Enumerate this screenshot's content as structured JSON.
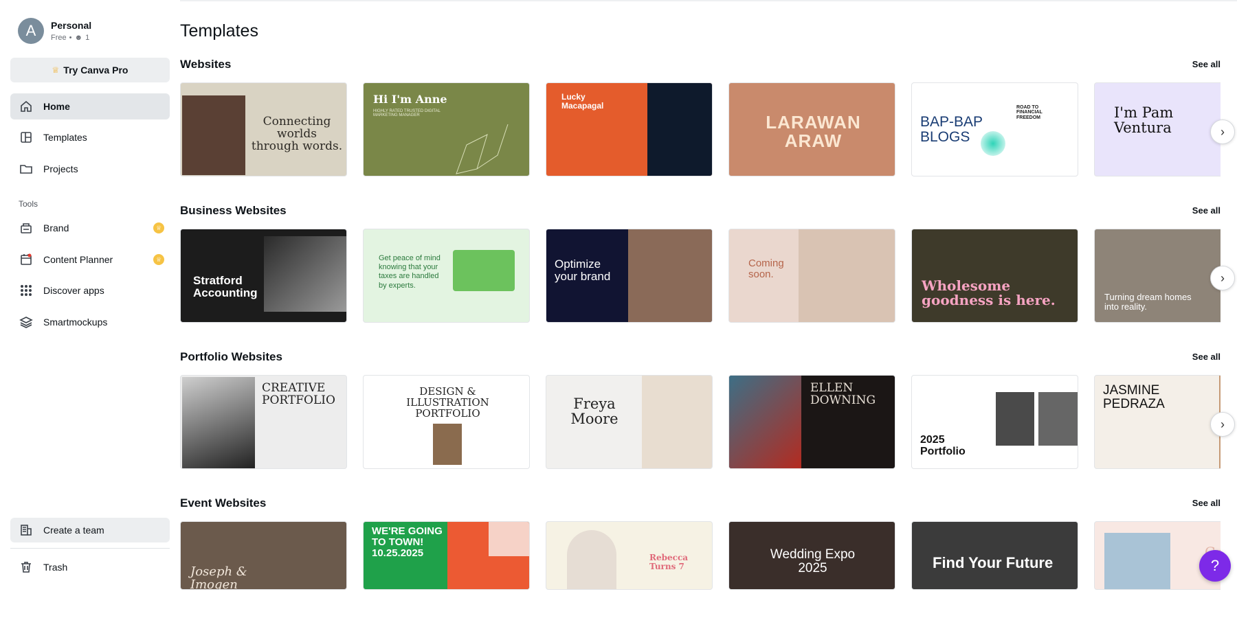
{
  "account": {
    "initial": "A",
    "name": "Personal",
    "plan": "Free",
    "members": "1"
  },
  "sidebar": {
    "try_pro": "Try Canva Pro",
    "nav": [
      {
        "label": "Home",
        "icon": "home-icon"
      },
      {
        "label": "Templates",
        "icon": "templates-icon"
      },
      {
        "label": "Projects",
        "icon": "folder-icon"
      }
    ],
    "tools_label": "Tools",
    "tools": [
      {
        "label": "Brand",
        "icon": "brand-icon"
      },
      {
        "label": "Content Planner",
        "icon": "calendar-icon"
      },
      {
        "label": "Discover apps",
        "icon": "apps-grid-icon"
      },
      {
        "label": "Smartmockups",
        "icon": "layers-icon"
      }
    ],
    "create_team": "Create a team",
    "trash": "Trash"
  },
  "main": {
    "title": "Templates",
    "see_all": "See all",
    "rows": [
      {
        "title": "Websites",
        "cards": [
          {
            "line1": "Connecting worlds",
            "line2": "through words."
          },
          {
            "line1": "Hi I'm Anne",
            "line2": "HIGHLY RATED TRUSTED DIGITAL MARKETING MANAGER"
          },
          {
            "line1": "Lucky",
            "line2": "Macapagal"
          },
          {
            "line1": "LARAWAN",
            "line2": "ARAW"
          },
          {
            "line1": "BAP-BAP",
            "line2": "BLOGS",
            "line3": "ROAD TO FINANCIAL FREEDOM"
          },
          {
            "line1": "I'm Pam",
            "line2": "Ventura"
          }
        ]
      },
      {
        "title": "Business Websites",
        "cards": [
          {
            "line1": "Stratford",
            "line2": "Accounting"
          },
          {
            "line1": "Get peace of mind knowing that your taxes are handled by experts."
          },
          {
            "line1": "Optimize",
            "line2": "your brand"
          },
          {
            "line1": "Coming",
            "line2": "soon."
          },
          {
            "line1": "Wholesome",
            "line2": "goodness is here."
          },
          {
            "line1": "Turning dream homes",
            "line2": "into reality."
          }
        ]
      },
      {
        "title": "Portfolio Websites",
        "cards": [
          {
            "line1": "CREATIVE",
            "line2": "PORTFOLIO"
          },
          {
            "line1": "DESIGN &",
            "line2": "ILLUSTRATION",
            "line3": "PORTFOLIO"
          },
          {
            "line1": "Freya",
            "line2": "Moore"
          },
          {
            "line1": "ELLEN",
            "line2": "DOWNING"
          },
          {
            "line1": "2025",
            "line2": "Portfolio"
          },
          {
            "line1": "JASMINE",
            "line2": "PEDRAZA"
          }
        ]
      },
      {
        "title": "Event Websites",
        "cards": [
          {
            "line1": "Joseph &",
            "line2": "Imogen"
          },
          {
            "line1": "WE'RE GOING",
            "line2": "TO TOWN!",
            "line3": "10.25.2025"
          },
          {
            "line1": "Rebecca",
            "line2": "Turns 7"
          },
          {
            "line1": "Wedding Expo",
            "line2": "2025"
          },
          {
            "line1": "Find Your Future"
          },
          {
            "line1": "Grea"
          }
        ]
      }
    ]
  },
  "help_label": "?"
}
